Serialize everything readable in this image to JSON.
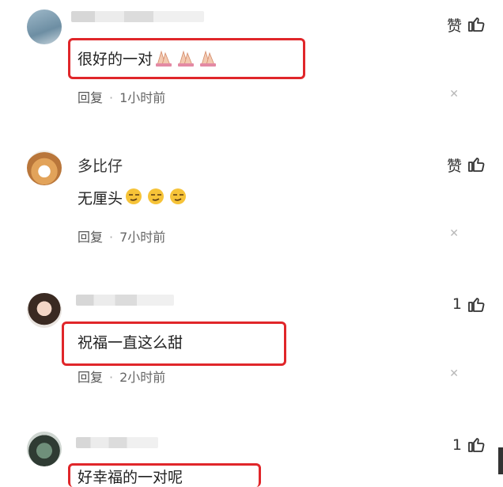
{
  "comments": [
    {
      "username": "",
      "username_blurred": true,
      "like_label": "赞",
      "content": "很好的一对",
      "emoji": [
        "praying-hands",
        "praying-hands",
        "praying-hands"
      ],
      "reply_label": "回复",
      "time": "1小时前",
      "highlighted": true
    },
    {
      "username": "多比仔",
      "username_blurred": false,
      "like_label": "赞",
      "content": "无厘头",
      "emoji": [
        "smirk-face",
        "smirk-face",
        "smirk-face"
      ],
      "reply_label": "回复",
      "time": "7小时前",
      "highlighted": false
    },
    {
      "username": "",
      "username_blurred": true,
      "like_label": "1",
      "content": "祝福一直这么甜",
      "emoji": [],
      "reply_label": "回复",
      "time": "2小时前",
      "highlighted": true
    },
    {
      "username": "",
      "username_blurred": true,
      "like_label": "1",
      "content": "好幸福的一对呢",
      "emoji": [],
      "reply_label": "",
      "time": "",
      "highlighted": true
    }
  ],
  "icons": {
    "like": "thumbs-up-icon",
    "close": "close-icon"
  },
  "colors": {
    "highlight_border": "#e0262a",
    "text": "#333333",
    "meta": "#666666"
  }
}
